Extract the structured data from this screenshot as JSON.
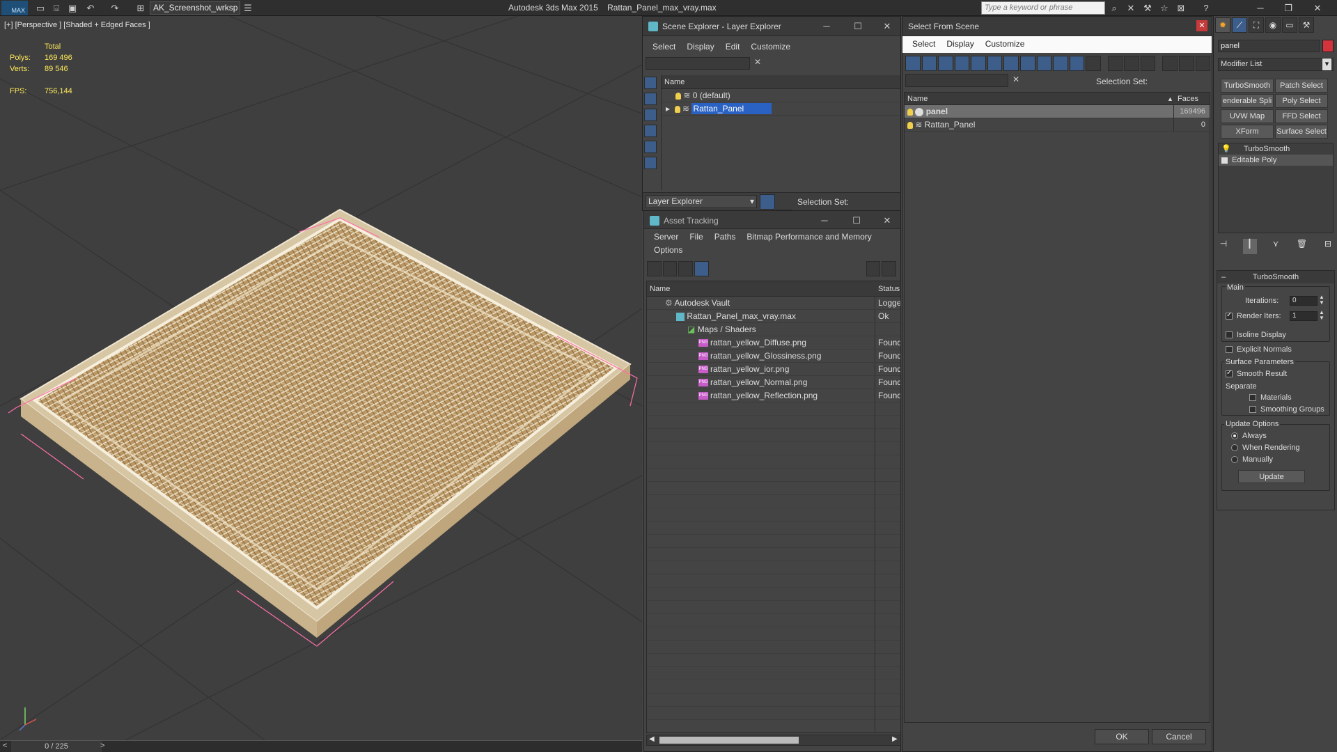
{
  "titlebar": {
    "app_badge": "MAX",
    "workspace": "AK_Screenshot_wrksp",
    "app_name": "Autodesk 3ds Max  2015",
    "file_name": "Rattan_Panel_max_vray.max",
    "search_placeholder": "Type a keyword or phrase"
  },
  "viewport": {
    "label": "[+] [Perspective ] [Shaded + Edged Faces ]",
    "stats": {
      "total_label": "Total",
      "polys_label": "Polys:",
      "polys": "169 496",
      "verts_label": "Verts:",
      "verts": "89 546",
      "fps_label": "FPS:",
      "fps": "756,144"
    }
  },
  "timeline": {
    "frame": "0 / 225",
    "prev": "<",
    "next": ">"
  },
  "scene_explorer": {
    "title": "Scene Explorer - Layer Explorer",
    "menu": [
      "Select",
      "Display",
      "Edit",
      "Customize"
    ],
    "column": "Name",
    "rows": [
      {
        "name": "0 (default)",
        "selected": false
      },
      {
        "name": "Rattan_Panel",
        "selected": true
      }
    ],
    "footer_dropdown": "Layer Explorer",
    "selection_set_label": "Selection Set:"
  },
  "asset_tracking": {
    "title": "Asset Tracking",
    "menu": [
      "Server",
      "File",
      "Paths",
      "Bitmap Performance and Memory",
      "Options"
    ],
    "columns": [
      "Name",
      "Status"
    ],
    "rows": [
      {
        "name": "Autodesk Vault",
        "status": "Logged"
      },
      {
        "name": "Rattan_Panel_max_vray.max",
        "status": "Ok"
      },
      {
        "name": "Maps / Shaders",
        "status": ""
      },
      {
        "name": "rattan_yellow_Diffuse.png",
        "status": "Found"
      },
      {
        "name": "rattan_yellow_Glossiness.png",
        "status": "Found"
      },
      {
        "name": "rattan_yellow_ior.png",
        "status": "Found"
      },
      {
        "name": "rattan_yellow_Normal.png",
        "status": "Found"
      },
      {
        "name": "rattan_yellow_Reflection.png",
        "status": "Found"
      }
    ]
  },
  "select_from_scene": {
    "title": "Select From Scene",
    "menu": [
      "Select",
      "Display",
      "Customize"
    ],
    "selection_set_label": "Selection Set:",
    "columns": [
      "Name",
      "Faces"
    ],
    "rows": [
      {
        "name": "panel",
        "faces": "169496",
        "selected": true
      },
      {
        "name": "Rattan_Panel",
        "faces": "0",
        "selected": false
      }
    ],
    "ok_label": "OK",
    "cancel_label": "Cancel"
  },
  "command_panel": {
    "name_field": "panel",
    "modifier_list": "Modifier List",
    "modifier_buttons": [
      "TurboSmooth",
      "Patch Select",
      "enderable Spli",
      "Poly Select",
      "UVW Map",
      "FFD Select",
      "XForm",
      "Surface Select"
    ],
    "stack": [
      "TurboSmooth",
      "Editable Poly"
    ],
    "rollout_title": "TurboSmooth",
    "main_label": "Main",
    "iterations_label": "Iterations:",
    "iterations": "0",
    "render_iters_label": "Render Iters:",
    "render_iters": "1",
    "isoline_label": "Isoline Display",
    "explicit_normals_label": "Explicit Normals",
    "surface_params_label": "Surface Parameters",
    "smooth_result_label": "Smooth Result",
    "separate_label": "Separate",
    "materials_label": "Materials",
    "smoothing_groups_label": "Smoothing Groups",
    "update_options_label": "Update Options",
    "always_label": "Always",
    "when_rendering_label": "When Rendering",
    "manually_label": "Manually",
    "update_button": "Update"
  },
  "colors": {
    "selection_blue": "#2a62c4",
    "stat_yellow": "#ffe95a",
    "bbox_pink": "#ff6fa8",
    "rattan": "#c8aa7a"
  }
}
